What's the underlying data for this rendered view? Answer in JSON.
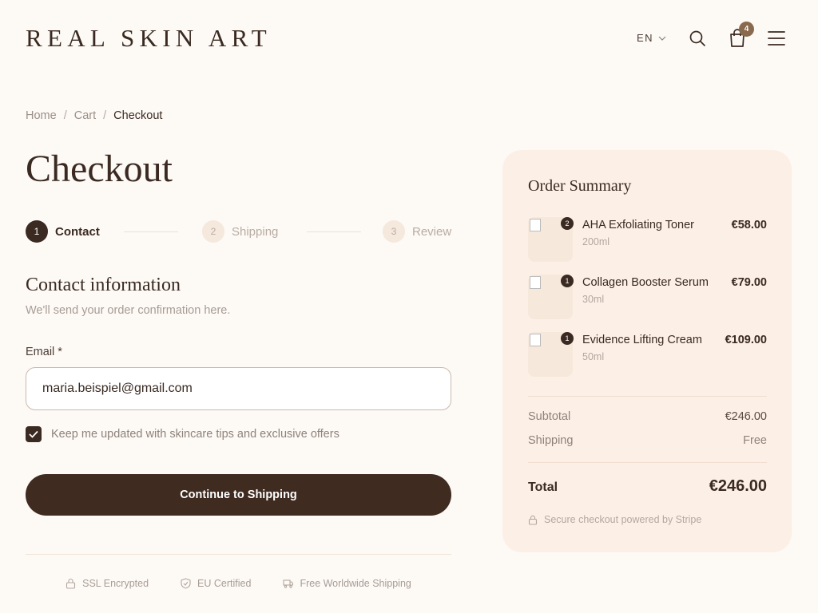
{
  "header": {
    "logo": "REAL SKIN ART",
    "language": "EN",
    "cart_count": "4"
  },
  "breadcrumb": {
    "home": "Home",
    "cart": "Cart",
    "current": "Checkout",
    "separator": "/"
  },
  "page": {
    "title": "Checkout"
  },
  "stepper": {
    "steps": [
      {
        "number": "1",
        "label": "Contact",
        "state": "active"
      },
      {
        "number": "2",
        "label": "Shipping",
        "state": "inactive"
      },
      {
        "number": "3",
        "label": "Review",
        "state": "inactive"
      }
    ]
  },
  "contact": {
    "title": "Contact information",
    "subtitle": "We'll send your order confirmation here.",
    "email_label": "Email *",
    "email_value": "maria.beispiel@gmail.com",
    "optin_checked": true,
    "optin_label": "Keep me updated with skincare tips and exclusive offers",
    "continue_label": "Continue to Shipping"
  },
  "trust": {
    "items": [
      {
        "label": "SSL Encrypted",
        "icon": "lock-icon"
      },
      {
        "label": "EU Certified",
        "icon": "shield-check-icon"
      },
      {
        "label": "Free Worldwide Shipping",
        "icon": "truck-icon"
      }
    ]
  },
  "summary": {
    "title": "Order Summary",
    "items": [
      {
        "name": "AHA Exfoliating Toner",
        "size": "200ml",
        "price": "€58.00",
        "qty": "2"
      },
      {
        "name": "Collagen Booster Serum",
        "size": "30ml",
        "price": "€79.00",
        "qty": "1"
      },
      {
        "name": "Evidence Lifting Cream",
        "size": "50ml",
        "price": "€109.00",
        "qty": "1"
      }
    ],
    "subtotal_label": "Subtotal",
    "subtotal_value": "€246.00",
    "shipping_label": "Shipping",
    "shipping_value": "Free",
    "total_label": "Total",
    "total_value": "€246.00",
    "secure_note": "Secure checkout powered by Stripe"
  },
  "colors": {
    "background": "#fdf9f5",
    "primary": "#3f2b20",
    "summary_bg": "#fcefe6",
    "badge": "#8a6a4e"
  }
}
